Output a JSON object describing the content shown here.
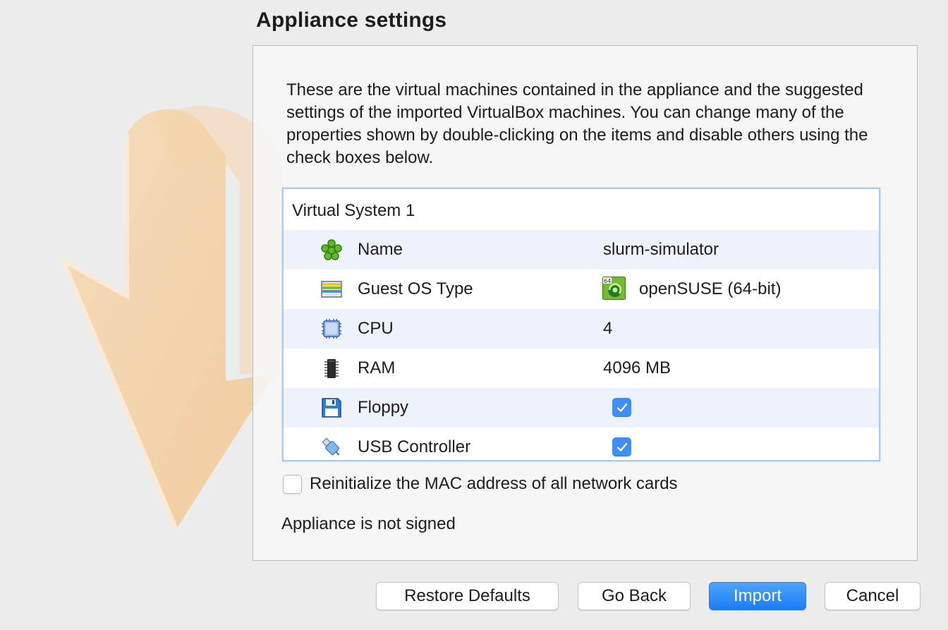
{
  "page_title": "Appliance settings",
  "description": "These are the virtual machines contained in the appliance and the suggested settings of the imported VirtualBox machines. You can change many of the properties shown by double-clicking on the items and disable others using the check boxes below.",
  "tree": {
    "header": "Virtual System 1",
    "rows": [
      {
        "icon": "name-icon",
        "label": "Name",
        "value": "slurm-simulator"
      },
      {
        "icon": "os-type-icon",
        "label": "Guest OS Type",
        "value": "openSUSE (64-bit)",
        "value_icon": "opensuse-icon",
        "value_icon_badge": "64"
      },
      {
        "icon": "cpu-icon",
        "label": "CPU",
        "value": "4"
      },
      {
        "icon": "ram-icon",
        "label": "RAM",
        "value": "4096 MB"
      },
      {
        "icon": "floppy-icon",
        "label": "Floppy",
        "checked": true
      },
      {
        "icon": "usb-icon",
        "label": "USB Controller",
        "checked": true
      }
    ]
  },
  "mac_option": {
    "label": "Reinitialize the MAC address of all network cards",
    "checked": false
  },
  "signature_status": "Appliance is not signed",
  "buttons": {
    "restore_defaults": "Restore Defaults",
    "go_back": "Go Back",
    "import": "Import",
    "cancel": "Cancel"
  },
  "colors": {
    "accent": "#3d8ef5",
    "primary_button": "#1c7cf5",
    "row_alt": "#edf2fb"
  }
}
